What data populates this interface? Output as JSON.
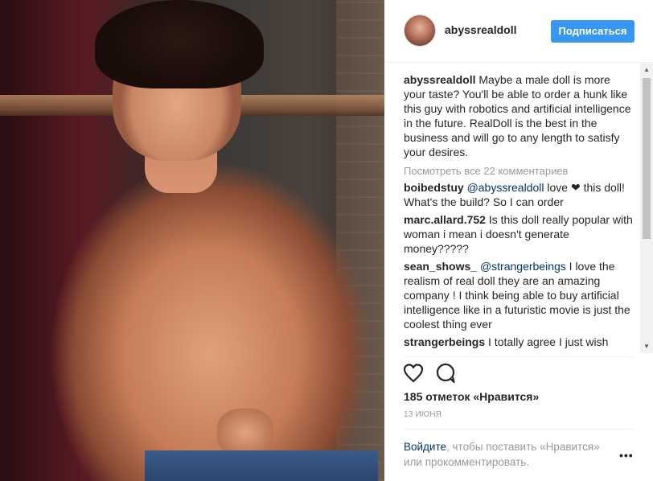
{
  "post": {
    "username": "abyssrealdoll",
    "follow_label": "Подписаться",
    "caption_user": "abyssrealdoll",
    "caption_text": "Maybe a male doll is more your taste? You'll be able to order a hunk like this guy with robotics and artificial intelligence in the future. RealDoll is the best in the business and will go to any length to satisfy your desires.",
    "view_all": "Посмотреть все 22 комментариев",
    "comments": [
      {
        "user": "boibedstuy",
        "mention": "@abyssrealdoll",
        "text_before_heart": " love ",
        "heart": "❤",
        "text": " this doll! What's the build? So I can order"
      },
      {
        "user": "marc.allard.752",
        "text": " Is this doll really popular with woman i mean i doesn't generate money?????"
      },
      {
        "user": "sean_shows_",
        "mention": "@strangerbeings",
        "text": " I love the realism of real doll they are an amazing company ! I think being able to buy artificial intelligence like in a futuristic movie is just the coolest thing ever"
      },
      {
        "user": "strangerbeings",
        "text": " I totally agree I just wish"
      }
    ],
    "likes": "185 отметок «Нравится»",
    "date": "13 ИЮНЯ",
    "login_link": "Войдите",
    "login_text": ", чтобы поставить «Нравится» или прокомментировать.",
    "more_label": "•••"
  },
  "icons": {
    "like": "heart-outline-icon",
    "comment": "speech-bubble-icon",
    "avatar": "profile-avatar"
  },
  "colors": {
    "follow_button": "#3897f0",
    "link": "#003569",
    "muted": "#999999",
    "text": "#262626"
  }
}
